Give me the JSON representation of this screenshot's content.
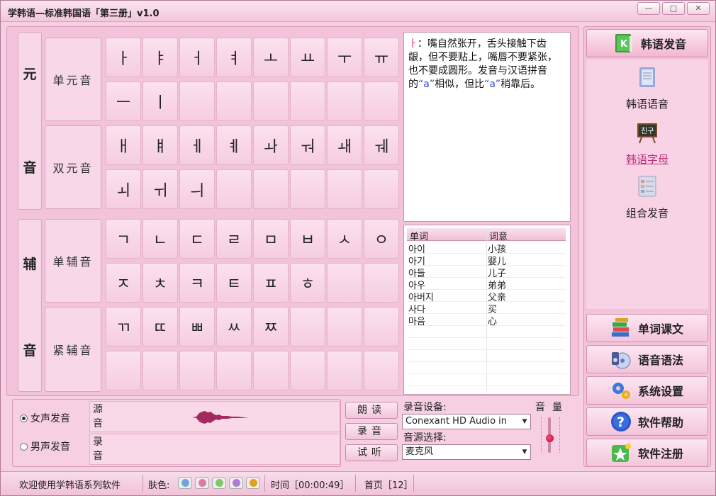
{
  "window": {
    "title": "学韩语—标准韩国语「第三册」v1.0",
    "controls": [
      "—",
      "□",
      "✕"
    ]
  },
  "labels": {
    "yuan": "元",
    "yin_top": "音",
    "fu": "辅",
    "yin_bottom": "音",
    "single_vowel": "单元音",
    "double_vowel": "双元音",
    "single_consonant": "单辅音",
    "tense_consonant": "紧辅音"
  },
  "grid": {
    "single_vowel_row1": [
      "ㅏ",
      "ㅑ",
      "ㅓ",
      "ㅕ",
      "ㅗ",
      "ㅛ",
      "ㅜ",
      "ㅠ"
    ],
    "single_vowel_row2": [
      "ㅡ",
      "ㅣ",
      "",
      "",
      "",
      "",
      "",
      ""
    ],
    "double_vowel_row1": [
      "ㅐ",
      "ㅒ",
      "ㅔ",
      "ㅖ",
      "ㅘ",
      "ㅝ",
      "ㅙ",
      "ㅞ"
    ],
    "double_vowel_row2": [
      "ㅚ",
      "ㅟ",
      "ㅢ",
      "",
      "",
      "",
      "",
      ""
    ],
    "single_consonant_row1": [
      "ㄱ",
      "ㄴ",
      "ㄷ",
      "ㄹ",
      "ㅁ",
      "ㅂ",
      "ㅅ",
      "ㅇ"
    ],
    "single_consonant_row2": [
      "ㅈ",
      "ㅊ",
      "ㅋ",
      "ㅌ",
      "ㅍ",
      "ㅎ",
      "",
      ""
    ],
    "tense_consonant_row1": [
      "ㄲ",
      "ㄸ",
      "ㅃ",
      "ㅆ",
      "ㅉ",
      "",
      "",
      ""
    ],
    "tense_consonant_row2": [
      "",
      "",
      "",
      "",
      "",
      "",
      "",
      ""
    ]
  },
  "description": {
    "letter": "ㅏ",
    "part1": "：嘴自然张开，舌头接触下齿龈，但不要贴上，嘴唇不要紧张，也不要成圆形。发音与汉语拼音的",
    "quote1": "“a”",
    "part2": "相似，但比",
    "quote2": "“a”",
    "part3": "稍靠后。"
  },
  "word_table": {
    "headers": [
      "单词",
      "词意"
    ],
    "rows": [
      [
        "아이",
        "小孩"
      ],
      [
        "아기",
        "婴儿"
      ],
      [
        "아들",
        "儿子"
      ],
      [
        "아우",
        "弟弟"
      ],
      [
        "아버지",
        "父亲"
      ],
      [
        "사다",
        "买"
      ],
      [
        "마음",
        "心"
      ]
    ]
  },
  "voice": {
    "female": "女声发音",
    "male": "男声发音",
    "female_selected": true,
    "source_label": "源音",
    "record_label": "录音"
  },
  "play_buttons": {
    "read": "朗读",
    "record": "录音",
    "listen": "试听"
  },
  "recording": {
    "device_label": "录音设备:",
    "device_value": "Conexant HD Audio in",
    "source_label": "音源选择:",
    "source_value": "麦克风",
    "volume_label": "音量",
    "volume_level": 0.5
  },
  "nav": {
    "top": "韩语发音",
    "sub_items": [
      "韩语语音",
      "韩语字母",
      "组合发音"
    ],
    "sub_active_index": 1,
    "buttons": [
      "单词课文",
      "语音语法",
      "系统设置",
      "软件帮助",
      "软件注册"
    ]
  },
  "status": {
    "welcome": "欢迎使用学韩语系列软件",
    "skin_label": "肤色:",
    "skin_colors": [
      "#6fa6d6",
      "#e07aa8",
      "#7ec86a",
      "#b07ad8",
      "#e0a020"
    ],
    "time": "时间［00:00:49］",
    "page": "首页［12］"
  },
  "colors": {
    "accent_pink": "#e0336e",
    "blue_text": "#2a4ed0",
    "link_active": "#c0307a"
  }
}
